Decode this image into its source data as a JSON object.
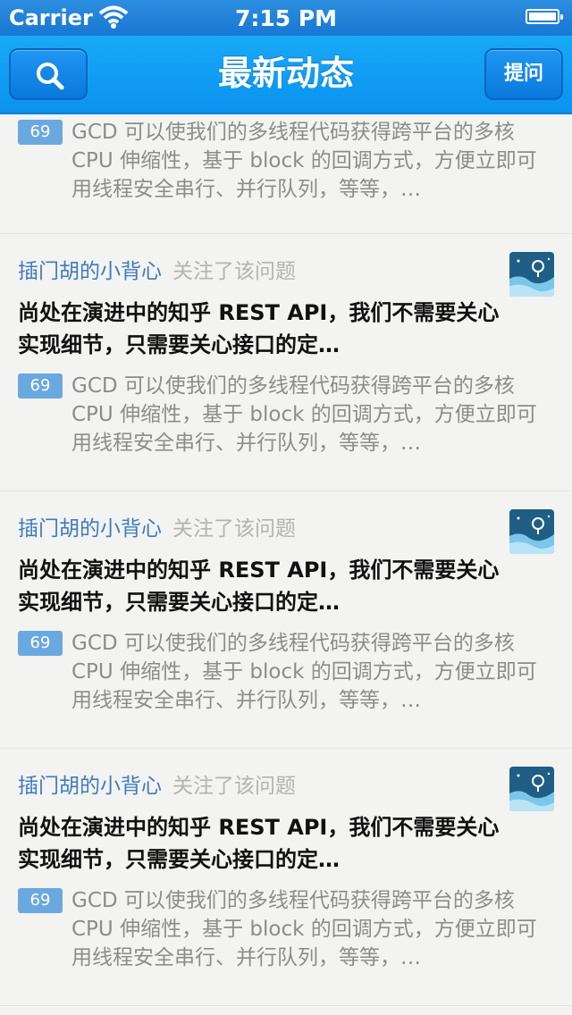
{
  "status_bar": {
    "carrier": "Carrier",
    "time": "7:15 PM"
  },
  "nav": {
    "title": "最新动态",
    "ask_label": "提问"
  },
  "feed": {
    "items": [
      {
        "votes": "69",
        "excerpt": "GCD 可以使我们的多线程代码获得跨平台的多核 CPU 伸缩性，基于 block 的回调方式，方便立即可用线程安全串行、并行队列，等等，…"
      },
      {
        "user": "插门胡的小背心",
        "action": "关注了该问题",
        "question": "尚处在演进中的知乎 REST API，我们不需要关心实现细节，只需要关心接口的定…",
        "votes": "69",
        "excerpt": "GCD 可以使我们的多线程代码获得跨平台的多核 CPU 伸缩性，基于 block 的回调方式，方便立即可用线程安全串行、并行队列，等等，…"
      },
      {
        "user": "插门胡的小背心",
        "action": "关注了该问题",
        "question": "尚处在演进中的知乎 REST API，我们不需要关心实现细节，只需要关心接口的定…",
        "votes": "69",
        "excerpt": "GCD 可以使我们的多线程代码获得跨平台的多核 CPU 伸缩性，基于 block 的回调方式，方便立即可用线程安全串行、并行队列，等等，…"
      },
      {
        "user": "插门胡的小背心",
        "action": "关注了该问题",
        "question": "尚处在演进中的知乎 REST API，我们不需要关心实现细节，只需要关心接口的定…",
        "votes": "69",
        "excerpt": "GCD 可以使我们的多线程代码获得跨平台的多核 CPU 伸缩性，基于 block 的回调方式，方便立即可用线程安全串行、并行队列，等等，…"
      }
    ]
  },
  "icons": {
    "search": "search-icon",
    "wifi": "wifi-icon",
    "battery": "battery-icon",
    "avatar": "avatar-image"
  },
  "colors": {
    "nav_bar": "#0b92ef",
    "user_link": "#3e7bbf",
    "vote_badge": "#6aa9df"
  }
}
